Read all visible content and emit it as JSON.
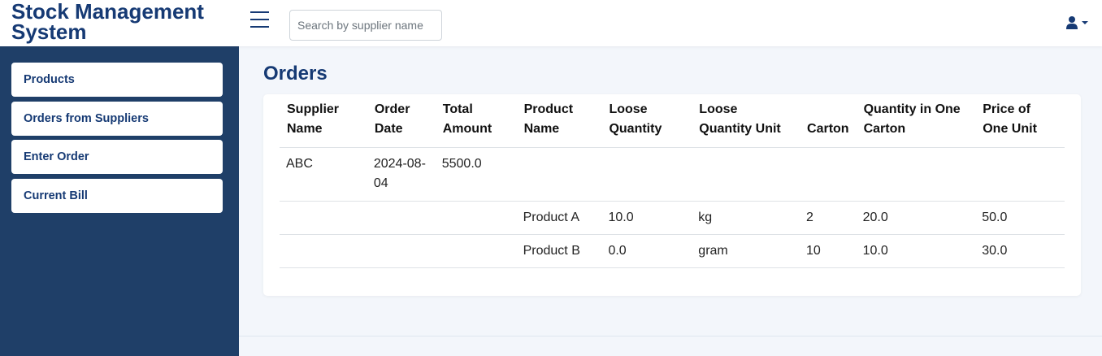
{
  "app": {
    "title": "Stock Management System"
  },
  "header": {
    "search_placeholder": "Search by supplier name"
  },
  "sidebar": {
    "items": [
      {
        "label": "Products"
      },
      {
        "label": "Orders from Suppliers"
      },
      {
        "label": "Enter Order"
      },
      {
        "label": "Current Bill"
      }
    ]
  },
  "main": {
    "title": "Orders",
    "table": {
      "headers": [
        "Supplier Name",
        "Order Date",
        "Total Amount",
        "Product Name",
        "Loose Quantity",
        "Loose Quantity Unit",
        "Carton",
        "Quantity in One Carton",
        "Price of One Unit"
      ],
      "order": {
        "supplier": "ABC",
        "date": "2024-08-04",
        "total": "5500.0"
      },
      "items": [
        {
          "product": "Product A",
          "loose_qty": "10.0",
          "unit": "kg",
          "carton": "2",
          "qty_per_carton": "20.0",
          "price": "50.0"
        },
        {
          "product": "Product B",
          "loose_qty": "0.0",
          "unit": "gram",
          "carton": "10",
          "qty_per_carton": "10.0",
          "price": "30.0"
        }
      ]
    }
  },
  "colors": {
    "primary": "#163a74",
    "sidebar_bg": "#1f3f68",
    "page_bg": "#f3f6fb"
  }
}
